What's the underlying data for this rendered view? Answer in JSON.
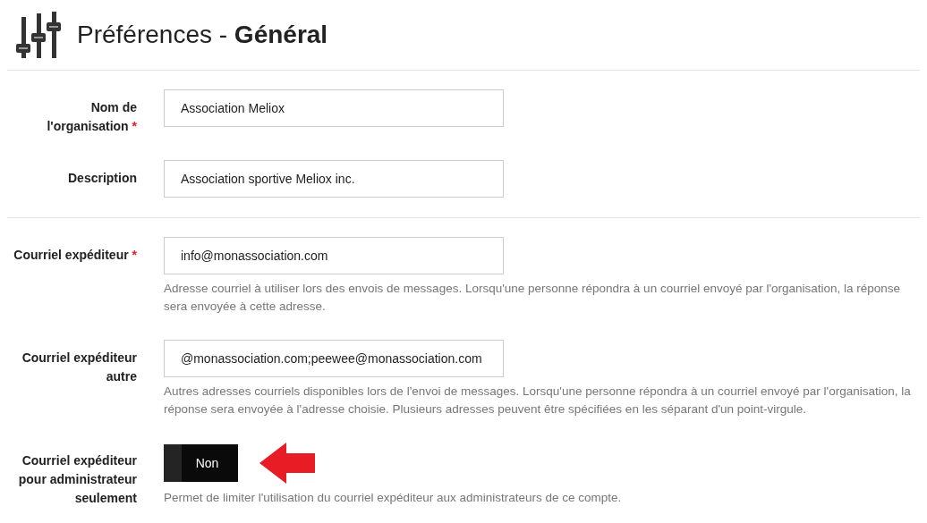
{
  "header": {
    "title": "Préférences - **Général**"
  },
  "sections": [
    {
      "fields": [
        {
          "kind": "text",
          "label": "Nom de l'organisation",
          "required_mark": "*",
          "value": "Association Meliox"
        },
        {
          "kind": "text",
          "label": "Description",
          "value": "Association sportive Meliox inc."
        }
      ]
    },
    {
      "fields": [
        {
          "kind": "text",
          "label": "Courriel expéditeur",
          "required_mark": "*",
          "value": "info@monassociation.com",
          "help": "Adresse courriel à utiliser lors des envois de messages. Lorsqu'une personne répondra à un courriel envoyé par l'organisation, la réponse sera envoyée à cette adresse."
        },
        {
          "kind": "text",
          "label": "Courriel expéditeur autre",
          "value": "@monassociation.com;peewee@monassociation.com",
          "help": "Autres adresses courriels disponibles lors de l'envoi de messages. Lorsqu'une personne répondra à un courriel envoyé par l'organisation, la réponse sera envoyée à l'adresse choisie. Plusieurs adresses peuvent être spécifiées en les séparant d'un point-virgule."
        },
        {
          "kind": "toggle",
          "label": "Courriel expéditeur pour administrateur seulement",
          "on": false,
          "state_label": "Non",
          "help": "Permet de limiter l'utilisation du courriel expéditeur aux administrateurs de ce compte."
        }
      ]
    }
  ]
}
